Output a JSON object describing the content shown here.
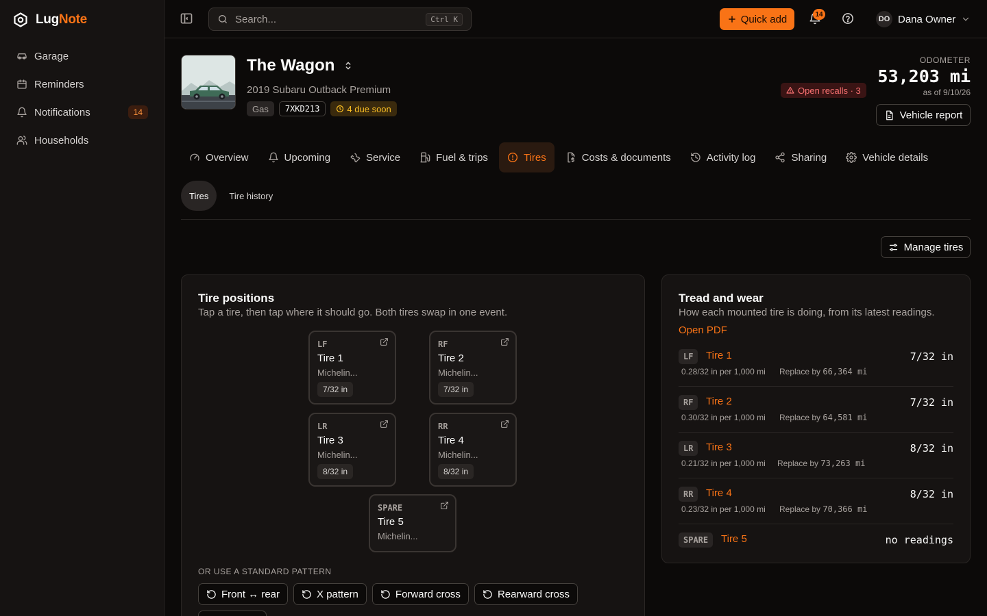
{
  "app": {
    "name_part1": "Lug",
    "name_part2": "Note"
  },
  "sidebar": {
    "items": [
      {
        "label": "Garage",
        "icon": "car-icon"
      },
      {
        "label": "Reminders",
        "icon": "calendar-icon"
      },
      {
        "label": "Notifications",
        "icon": "bell-icon",
        "badge": "14"
      },
      {
        "label": "Households",
        "icon": "users-icon"
      }
    ]
  },
  "topbar": {
    "search_placeholder": "Search...",
    "search_shortcut": "Ctrl K",
    "quick_add_label": "Quick add",
    "notification_count": "14",
    "user_initials": "DO",
    "user_name": "Dana Owner"
  },
  "vehicle": {
    "name": "The Wagon",
    "subtitle": "2019 Subaru Outback Premium",
    "fuel": "Gas",
    "plate": "7XKD213",
    "due_soon": "4 due soon",
    "recalls": "Open recalls · 3",
    "odometer_label": "ODOMETER",
    "odometer_value": "53,203 mi",
    "odometer_asof": "as of 9/10/26",
    "report_label": "Vehicle report"
  },
  "tabs": [
    {
      "label": "Overview",
      "icon": "gauge-icon"
    },
    {
      "label": "Upcoming",
      "icon": "bell-icon"
    },
    {
      "label": "Service",
      "icon": "wrench-icon"
    },
    {
      "label": "Fuel & trips",
      "icon": "fuel-icon"
    },
    {
      "label": "Tires",
      "icon": "tire-icon",
      "active": true
    },
    {
      "label": "Costs & documents",
      "icon": "document-dollar-icon"
    },
    {
      "label": "Activity log",
      "icon": "history-icon"
    },
    {
      "label": "Sharing",
      "icon": "share-icon"
    },
    {
      "label": "Vehicle details",
      "icon": "gear-icon"
    }
  ],
  "subtabs": [
    {
      "label": "Tires",
      "active": true
    },
    {
      "label": "Tire history"
    }
  ],
  "manage_tires_label": "Manage tires",
  "positions_card": {
    "title": "Tire positions",
    "description": "Tap a tire, then tap where it should go. Both tires swap in one event.",
    "tires": [
      {
        "pos": "LF",
        "name": "Tire 1",
        "brand": "Michelin...",
        "depth": "7/32 in"
      },
      {
        "pos": "RF",
        "name": "Tire 2",
        "brand": "Michelin...",
        "depth": "7/32 in"
      },
      {
        "pos": "LR",
        "name": "Tire 3",
        "brand": "Michelin...",
        "depth": "8/32 in"
      },
      {
        "pos": "RR",
        "name": "Tire 4",
        "brand": "Michelin...",
        "depth": "8/32 in"
      },
      {
        "pos": "SPARE",
        "name": "Tire 5",
        "brand": "Michelin..."
      }
    ],
    "pattern_label": "OR USE A STANDARD PATTERN",
    "patterns": [
      "Front ↔ rear",
      "X pattern",
      "Forward cross",
      "Rearward cross"
    ]
  },
  "tread_card": {
    "title": "Tread and wear",
    "description": "How each mounted tire is doing, from its latest readings.",
    "open_pdf": "Open PDF",
    "rows": [
      {
        "pos": "LF",
        "name": "Tire 1",
        "depth": "7/32 in",
        "rate": "0.28/32 in per 1,000 mi",
        "replace_label": "Replace by",
        "replace_value": "66,364 mi"
      },
      {
        "pos": "RF",
        "name": "Tire 2",
        "depth": "7/32 in",
        "rate": "0.30/32 in per 1,000 mi",
        "replace_label": "Replace by",
        "replace_value": "64,581 mi"
      },
      {
        "pos": "LR",
        "name": "Tire 3",
        "depth": "8/32 in",
        "rate": "0.21/32 in per 1,000 mi",
        "replace_label": "Replace by",
        "replace_value": "73,263 mi"
      },
      {
        "pos": "RR",
        "name": "Tire 4",
        "depth": "8/32 in",
        "rate": "0.23/32 in per 1,000 mi",
        "replace_label": "Replace by",
        "replace_value": "70,366 mi"
      },
      {
        "pos": "SPARE",
        "name": "Tire 5",
        "depth": "no readings"
      }
    ]
  },
  "colors": {
    "accent": "#f97316",
    "background": "#0c0a09",
    "surface": "#161312"
  }
}
